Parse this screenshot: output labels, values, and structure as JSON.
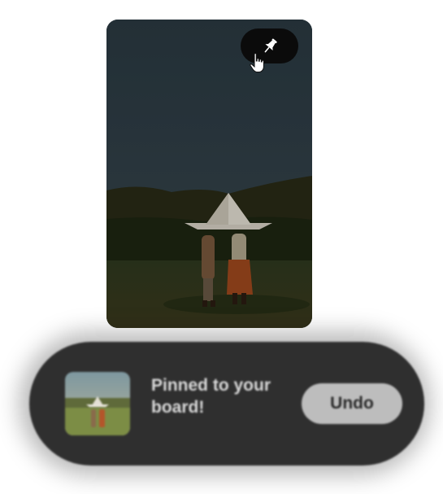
{
  "pin": {
    "image_alt": "Two people holding a large paper boat in a field",
    "pin_button_icon": "pushpin-icon",
    "cursor_icon": "hand-pointer-icon"
  },
  "toast": {
    "message": "Pinned to your board!",
    "undo_label": "Undo",
    "thumbnail_alt": "Pinned image thumbnail"
  },
  "colors": {
    "toast_bg": "#2f2f2f",
    "undo_bg": "#bdbdbd",
    "pin_button_bg": "#0b0b0b"
  }
}
